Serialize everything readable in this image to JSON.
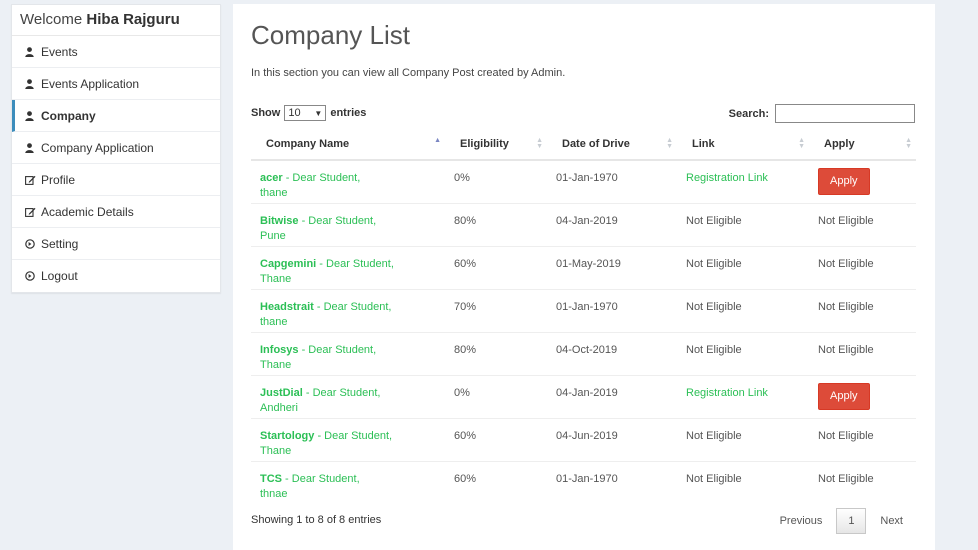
{
  "sidebar": {
    "welcome_prefix": "Welcome",
    "user_name": "Hiba Rajguru",
    "items": [
      {
        "label": "Events",
        "icon": "user-icon"
      },
      {
        "label": "Events Application",
        "icon": "user-icon"
      },
      {
        "label": "Company",
        "icon": "user-icon"
      },
      {
        "label": "Company Application",
        "icon": "user-icon"
      },
      {
        "label": "Profile",
        "icon": "edit-icon"
      },
      {
        "label": "Academic Details",
        "icon": "edit-icon"
      },
      {
        "label": "Setting",
        "icon": "circle-arrow-icon"
      },
      {
        "label": "Logout",
        "icon": "circle-arrow-icon"
      }
    ],
    "active_item": "Company"
  },
  "main": {
    "title": "Company List",
    "description": "In this section you can view all Company Post created by Admin.",
    "length": {
      "prefix": "Show",
      "value": "10",
      "suffix": "entries"
    },
    "search": {
      "label": "Search:",
      "value": ""
    },
    "columns": [
      "Company Name",
      "Eligibility",
      "Date of Drive",
      "Link",
      "Apply"
    ],
    "rows": [
      {
        "company": "acer",
        "note": " - Dear Student,",
        "city": "thane",
        "eligibility": "0%",
        "date": "01-Jan-1970",
        "link": "Registration Link",
        "apply": "Apply"
      },
      {
        "company": "Bitwise",
        "note": " - Dear Student,",
        "city": "Pune",
        "eligibility": "80%",
        "date": "04-Jan-2019",
        "link": "Not Eligible",
        "apply": "Not Eligible"
      },
      {
        "company": "Capgemini",
        "note": " - Dear Student,",
        "city": "Thane",
        "eligibility": "60%",
        "date": "01-May-2019",
        "link": "Not Eligible",
        "apply": "Not Eligible"
      },
      {
        "company": "Headstrait",
        "note": " - Dear Student,",
        "city": "thane",
        "eligibility": "70%",
        "date": "01-Jan-1970",
        "link": "Not Eligible",
        "apply": "Not Eligible"
      },
      {
        "company": "Infosys",
        "note": " - Dear Student,",
        "city": "Thane",
        "eligibility": "80%",
        "date": "04-Oct-2019",
        "link": "Not Eligible",
        "apply": "Not Eligible"
      },
      {
        "company": "JustDial",
        "note": " - Dear Student,",
        "city": "Andheri",
        "eligibility": "0%",
        "date": "04-Jan-2019",
        "link": "Registration Link",
        "apply": "Apply"
      },
      {
        "company": "Startology",
        "note": " - Dear Student,",
        "city": "Thane",
        "eligibility": "60%",
        "date": "04-Jun-2019",
        "link": "Not Eligible",
        "apply": "Not Eligible"
      },
      {
        "company": "TCS",
        "note": " - Dear Student,",
        "city": "thnae",
        "eligibility": "60%",
        "date": "01-Jan-1970",
        "link": "Not Eligible",
        "apply": "Not Eligible"
      }
    ],
    "footer": {
      "info": "Showing 1 to 8 of 8 entries",
      "previous": "Previous",
      "page": "1",
      "next": "Next"
    }
  },
  "colors": {
    "accent_green": "#2bbf55",
    "apply_red": "#dd4b39",
    "active_border": "#3c8dbc",
    "background": "#ecf0f5"
  }
}
